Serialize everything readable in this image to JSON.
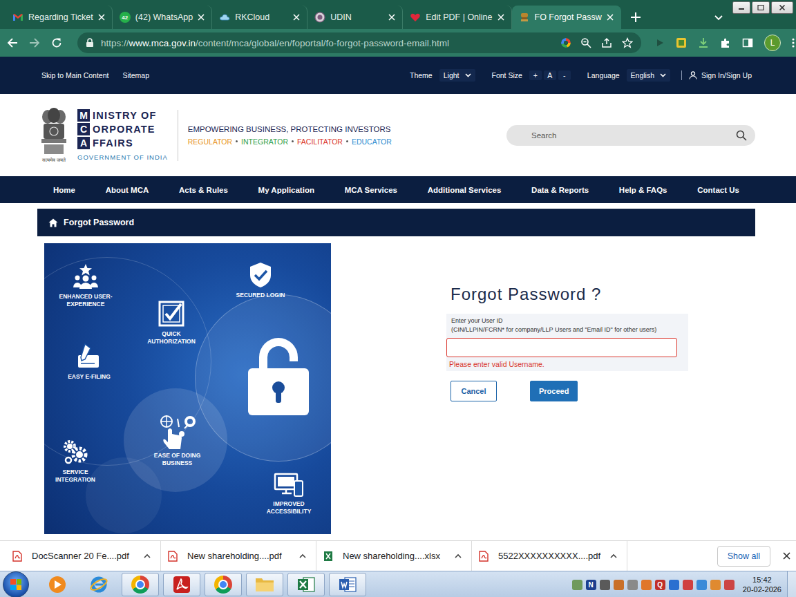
{
  "browser": {
    "tabs": [
      {
        "label": "Regarding Ticket",
        "kind": "gmail",
        "selected": false
      },
      {
        "label": "(42) WhatsApp",
        "kind": "whatsapp",
        "badge": "42",
        "selected": false
      },
      {
        "label": "RKCloud",
        "kind": "cloud",
        "selected": false
      },
      {
        "label": "UDIN",
        "kind": "udin",
        "selected": false
      },
      {
        "label": "Edit PDF | Online",
        "kind": "heart",
        "selected": false
      },
      {
        "label": "FO Forgot Passw",
        "kind": "emblem",
        "selected": true
      }
    ],
    "address": {
      "scheme": "https://",
      "host": "www.mca.gov.in",
      "path": "/content/mca/global/en/foportal/fo-forgot-password-email.html"
    },
    "profile": "L"
  },
  "page": {
    "utility_links": [
      "Skip to Main Content",
      "Sitemap"
    ],
    "theme": {
      "label": "Theme",
      "value": "Light"
    },
    "font_size": {
      "label": "Font Size",
      "controls": [
        "+",
        "A",
        "-"
      ]
    },
    "language": {
      "label": "Language",
      "value": "English"
    },
    "sign_in": "Sign In/Sign Up",
    "logo": {
      "lines": [
        {
          "initial": "M",
          "rest": "INISTRY OF"
        },
        {
          "initial": "C",
          "rest": "ORPORATE"
        },
        {
          "initial": "A",
          "rest": "FFAIRS"
        }
      ],
      "government": "GOVERNMENT OF INDIA",
      "motto": "सत्यमेव जयते"
    },
    "tagline": "EMPOWERING BUSINESS, PROTECTING INVESTORS",
    "roles": [
      {
        "label": "REGULATOR",
        "color": "#e8961e"
      },
      {
        "label": "INTEGRATOR",
        "color": "#2f9e4a"
      },
      {
        "label": "FACILITATOR",
        "color": "#d9342b"
      },
      {
        "label": "EDUCATOR",
        "color": "#2a8bd0"
      }
    ],
    "search": {
      "placeholder": "Search"
    },
    "nav": [
      "Home",
      "About MCA",
      "Acts & Rules",
      "My Application",
      "MCA Services",
      "Additional Services",
      "Data & Reports",
      "Help & FAQs",
      "Contact Us"
    ],
    "breadcrumb": "Forgot Password",
    "illustration": {
      "features": [
        {
          "kind": "users",
          "label": "ENHANCED USER-EXPERIENCE"
        },
        {
          "kind": "shield",
          "label": "SECURED LOGIN"
        },
        {
          "kind": "check",
          "label": "QUICK AUTHORIZATION"
        },
        {
          "kind": "pen",
          "label": "EASY E-FILING"
        },
        {
          "kind": "hand",
          "label": "EASE OF DOING BUSINESS"
        },
        {
          "kind": "gears",
          "label": "SERVICE INTEGRATION"
        },
        {
          "kind": "devices",
          "label": "IMPROVED ACCESSIBILITY"
        }
      ]
    },
    "form": {
      "title": "Forgot Password ?",
      "label": "Enter your User ID",
      "hint": "(CIN/LLPIN/FCRN* for company/LLP Users and \"Email ID\" for other users)",
      "value": "",
      "invalid": true,
      "error": "Please enter valid Username.",
      "cancel": "Cancel",
      "proceed": "Proceed"
    }
  },
  "downloads": {
    "items": [
      {
        "name": "DocScanner 20 Fe....pdf",
        "kind": "pdf"
      },
      {
        "name": "New shareholding....pdf",
        "kind": "pdf"
      },
      {
        "name": "New shareholding....xlsx",
        "kind": "xlsx"
      },
      {
        "name": "5522XXXXXXXXXX....pdf",
        "kind": "pdf"
      }
    ],
    "show_all": "Show all"
  },
  "taskbar": {
    "apps": [
      {
        "kind": "media",
        "running": false
      },
      {
        "kind": "ie",
        "running": false
      },
      {
        "kind": "chrome",
        "running": true
      },
      {
        "kind": "acrobat",
        "running": true
      },
      {
        "kind": "chrome",
        "running": true
      },
      {
        "kind": "folder",
        "running": true
      },
      {
        "kind": "excel",
        "running": true
      },
      {
        "kind": "word",
        "running": true
      }
    ],
    "tray": [
      {
        "glyph": "",
        "color": "#6f9a5c"
      },
      {
        "glyph": "N",
        "color": "#1d3f8f"
      },
      {
        "glyph": "",
        "color": "#5a5a5a"
      },
      {
        "glyph": "",
        "color": "#c9702a"
      },
      {
        "glyph": "",
        "color": "#8a8a8a"
      },
      {
        "glyph": "",
        "color": "#e0762a"
      },
      {
        "glyph": "Q",
        "color": "#c0302a"
      },
      {
        "glyph": "",
        "color": "#2a6fd0"
      },
      {
        "glyph": "",
        "color": "#d04040"
      },
      {
        "glyph": "",
        "color": "#3a8ad8"
      },
      {
        "glyph": "",
        "color": "#e08a30"
      },
      {
        "glyph": "",
        "color": "#cc4444"
      }
    ],
    "time": "15:42",
    "date": "20-02-2026"
  }
}
